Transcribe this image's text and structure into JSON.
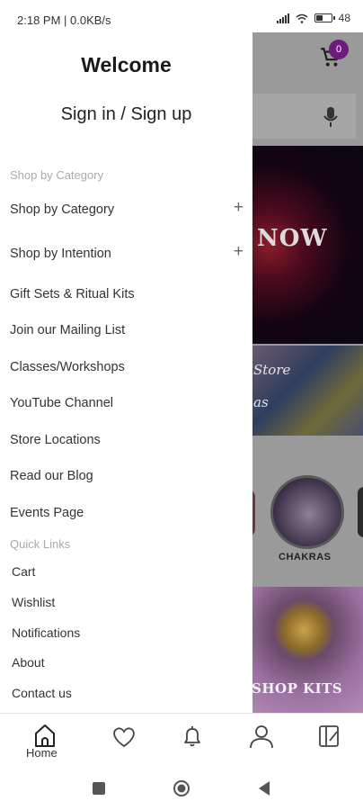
{
  "status_bar": {
    "time": "2:18 PM | 0.0KB/s",
    "battery": "48",
    "battery_level": 0.48
  },
  "background": {
    "cart_count": "0",
    "banner1_text": "NOW",
    "banner2_text": "Store",
    "banner2_sub": "as",
    "chakra_label": "CHAKRAS",
    "banner3_text": "SHOP KITS"
  },
  "drawer": {
    "welcome": "Welcome",
    "signin": "Sign in / Sign up",
    "section_category": "Shop by Category",
    "items": [
      {
        "label": "Shop by Category",
        "expandable": true
      },
      {
        "label": "Shop by Intention",
        "expandable": true
      },
      {
        "label": "Gift Sets & Ritual Kits"
      },
      {
        "label": "Join our Mailing List"
      },
      {
        "label": "Classes/Workshops"
      },
      {
        "label": "YouTube Channel"
      },
      {
        "label": "Store Locations"
      },
      {
        "label": "Read our Blog"
      },
      {
        "label": "Events Page"
      }
    ],
    "quick_links_label": "Quick Links",
    "quick_links": [
      "Cart",
      "Wishlist",
      "Notifications",
      "About",
      "Contact us"
    ]
  },
  "bottom_nav": {
    "home_label": "Home",
    "icons": [
      "home-icon",
      "heart-icon",
      "bell-icon",
      "user-icon",
      "catalog-icon"
    ]
  },
  "colors": {
    "accent": "#6b1b7a",
    "text": "#333333",
    "muted": "#aaaaaa"
  }
}
